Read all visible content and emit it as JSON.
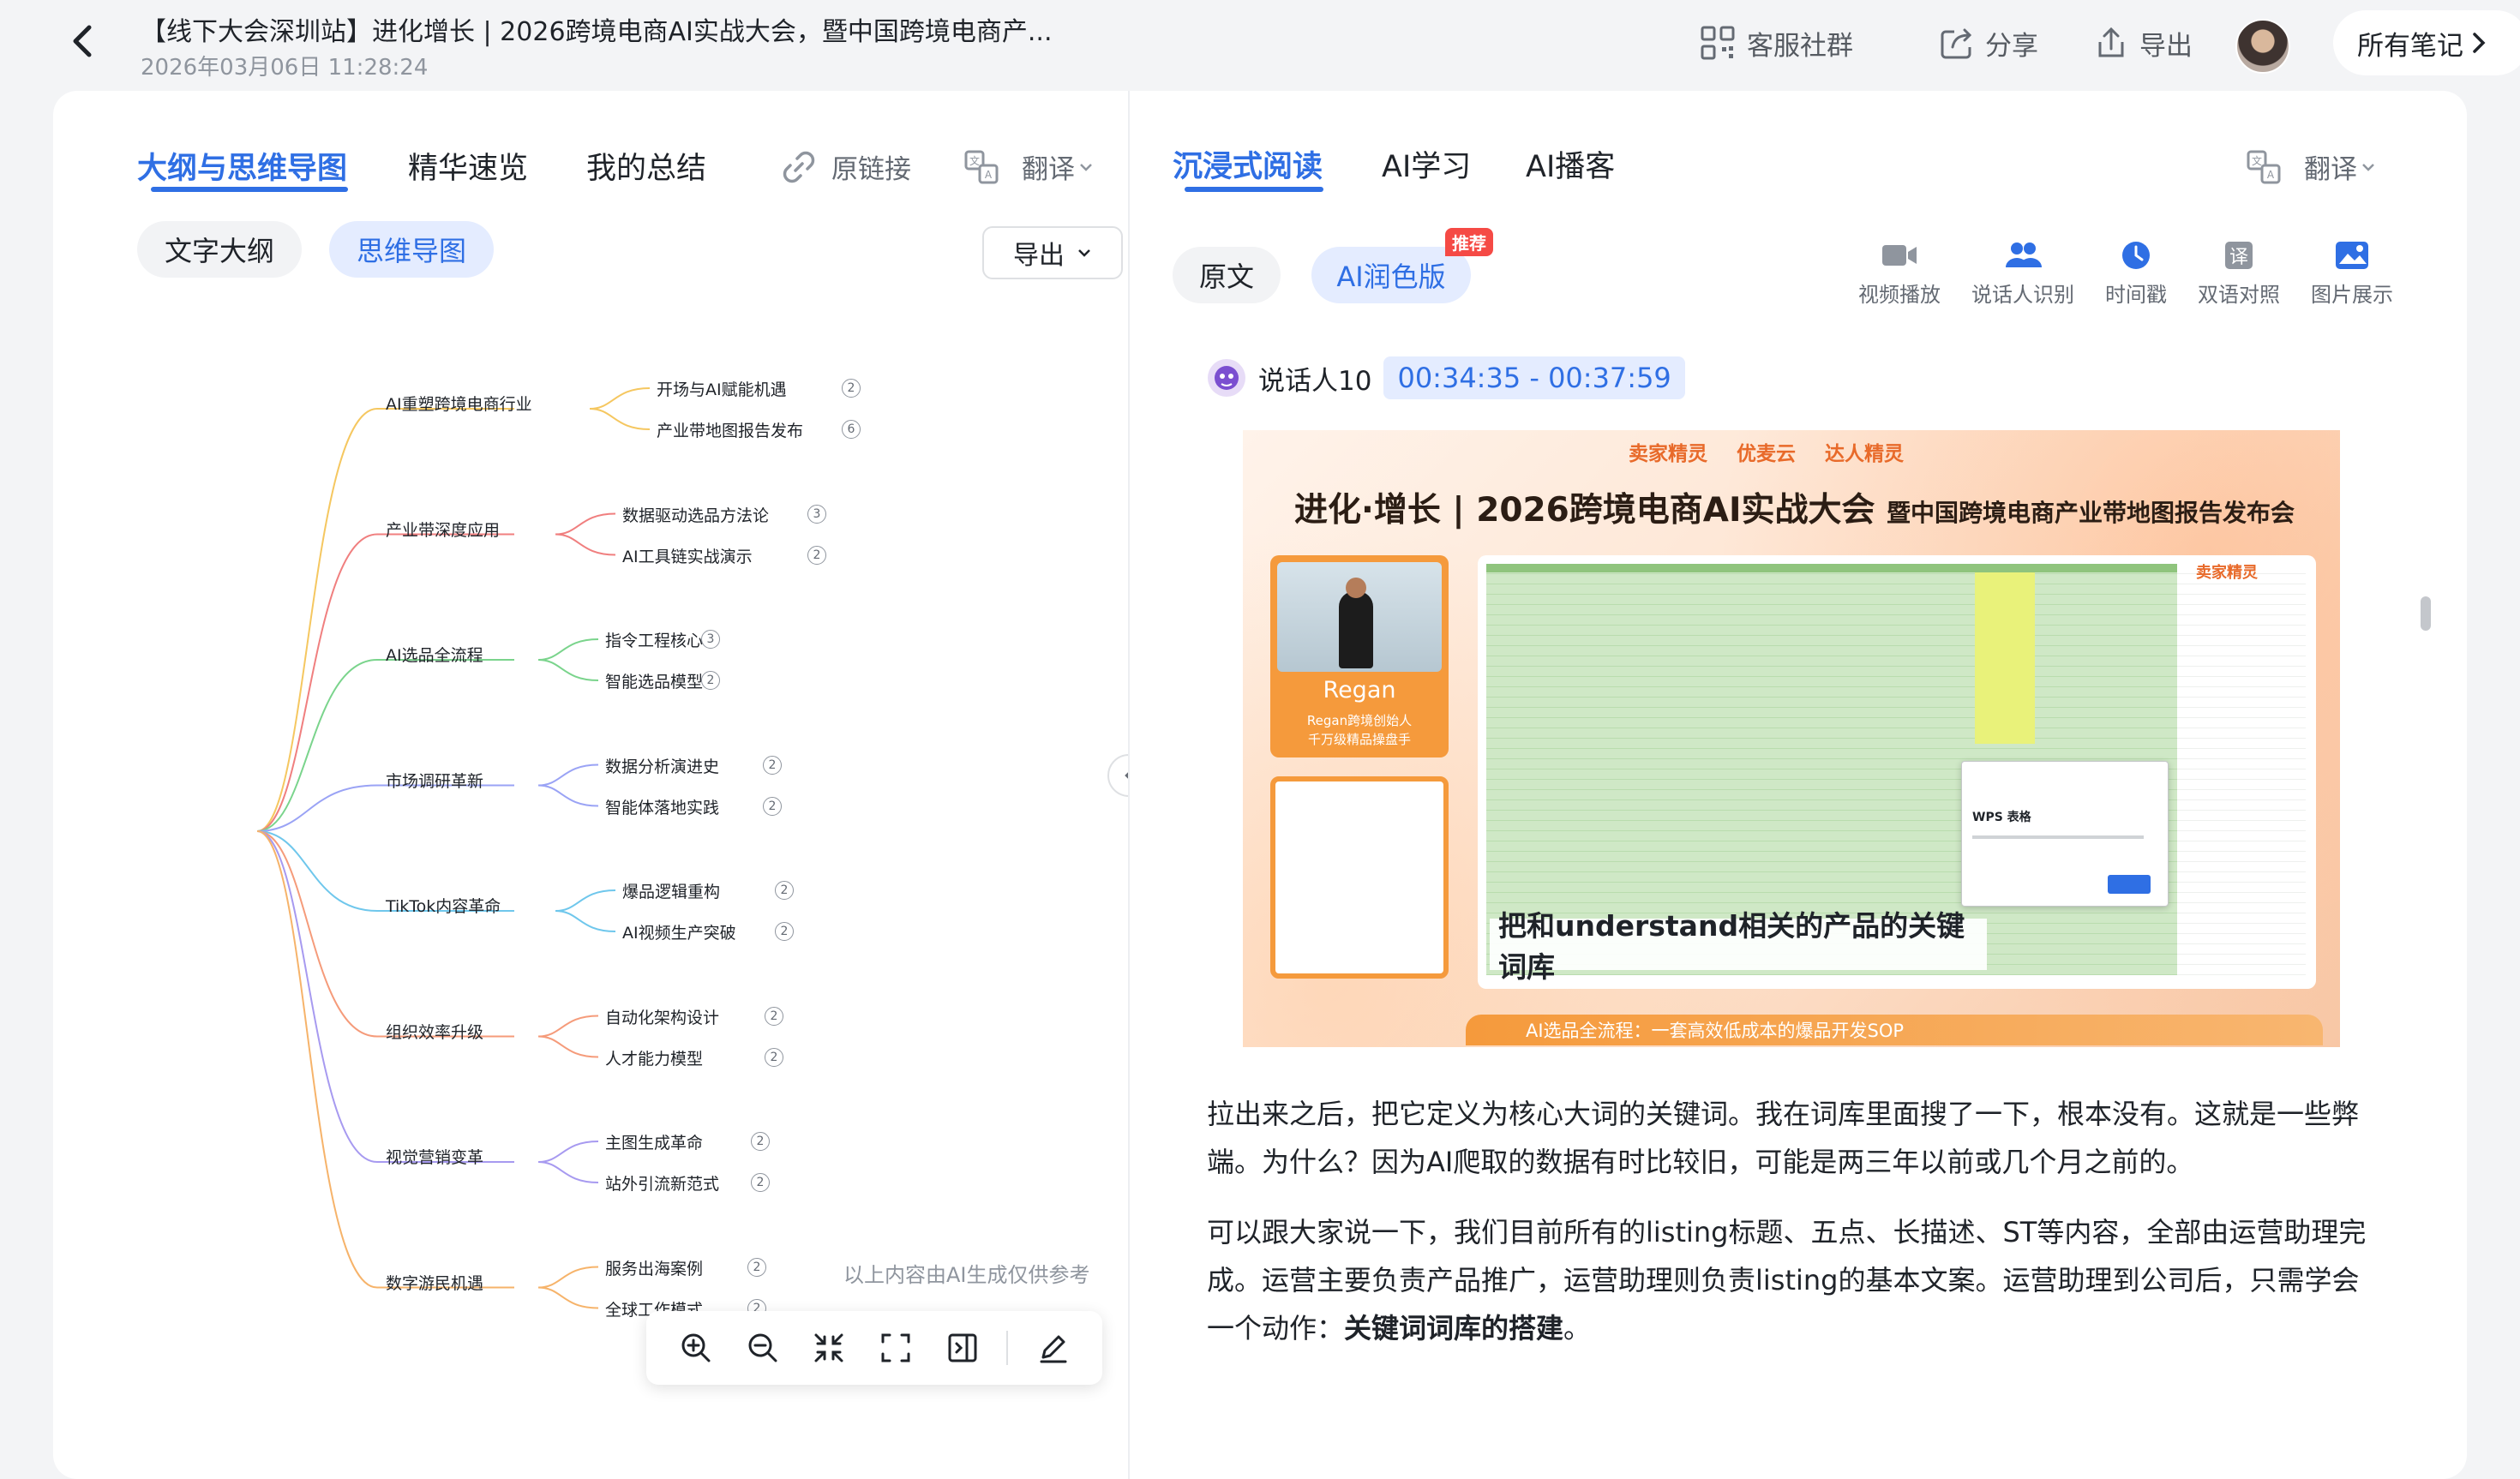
{
  "header": {
    "title": "【线下大会深圳站】进化增长 | 2026跨境电商AI实战大会，暨中国跨境电商产...",
    "datetime": "2026年03月06日 11:28:24",
    "customer_service": "客服社群",
    "share": "分享",
    "export": "导出",
    "all_notes": "所有笔记"
  },
  "left": {
    "tabs": [
      "大纲与思维导图",
      "精华速览",
      "我的总结"
    ],
    "source_link": "原链接",
    "translate": "翻译",
    "view_pills": [
      "文字大纲",
      "思维导图"
    ],
    "export_label": "导出",
    "ai_note": "以上内容由AI生成仅供参考",
    "mindmap": {
      "branches": [
        {
          "label": "AI重塑跨境电商行业",
          "color": "#f5c760",
          "children": [
            {
              "label": "开场与AI赋能机遇",
              "count": "2"
            },
            {
              "label": "产业带地图报告发布",
              "count": "6"
            }
          ]
        },
        {
          "label": "产业带深度应用",
          "color": "#f07f7f",
          "children": [
            {
              "label": "数据驱动选品方法论",
              "count": "3"
            },
            {
              "label": "AI工具链实战演示",
              "count": "2"
            }
          ]
        },
        {
          "label": "AI选品全流程",
          "color": "#7ad48c",
          "children": [
            {
              "label": "指令工程核心",
              "count": "3"
            },
            {
              "label": "智能选品模型",
              "count": "2"
            }
          ]
        },
        {
          "label": "市场调研革新",
          "color": "#9aa3f5",
          "children": [
            {
              "label": "数据分析演进史",
              "count": "2"
            },
            {
              "label": "智能体落地实践",
              "count": "2"
            }
          ]
        },
        {
          "label": "TikTok内容革命",
          "color": "#6fc7ec",
          "children": [
            {
              "label": "爆品逻辑重构",
              "count": "2"
            },
            {
              "label": "AI视频生产突破",
              "count": "2"
            }
          ]
        },
        {
          "label": "组织效率升级",
          "color": "#f59b7a",
          "children": [
            {
              "label": "自动化架构设计",
              "count": "2"
            },
            {
              "label": "人才能力模型",
              "count": "2"
            }
          ]
        },
        {
          "label": "视觉营销变革",
          "color": "#a79af0",
          "children": [
            {
              "label": "主图生成革命",
              "count": "2"
            },
            {
              "label": "站外引流新范式",
              "count": "2"
            }
          ]
        },
        {
          "label": "数字游民机遇",
          "color": "#f6b36a",
          "children": [
            {
              "label": "服务出海案例",
              "count": "2"
            },
            {
              "label": "全球工作模式",
              "count": "2"
            }
          ]
        }
      ]
    }
  },
  "right": {
    "tabs": [
      "沉浸式阅读",
      "AI学习",
      "AI播客"
    ],
    "translate": "翻译",
    "pills": [
      "原文",
      "AI润色版"
    ],
    "recommend_badge": "推荐",
    "tools": [
      {
        "label": "视频播放",
        "icon": "video-camera-icon"
      },
      {
        "label": "说话人识别",
        "icon": "speakers-icon"
      },
      {
        "label": "时间戳",
        "icon": "clock-icon"
      },
      {
        "label": "双语对照",
        "icon": "translate-icon"
      },
      {
        "label": "图片展示",
        "icon": "image-icon"
      }
    ],
    "speaker": {
      "name": "说话人10",
      "time": "00:34:35 - 00:37:59"
    },
    "slide": {
      "logos": [
        "卖家精灵",
        "优麦云",
        "达人精灵"
      ],
      "headline": "进化·增长 | 2026跨境电商AI实战大会",
      "headline_sub": "暨中国跨境电商产业带地图报告发布会",
      "speaker_name": "Regan",
      "speaker_role_1": "Regan跨境创始人",
      "speaker_role_2": "千万级精品操盘手",
      "caption": "把和understand相关的产品的关键词库",
      "footer": "AI选品全流程：一套高效低成本的爆品开发SOP",
      "corner_brand": "卖家精灵",
      "dialog_title": "WPS 表格"
    },
    "paragraphs": [
      {
        "text": "拉出来之后，把它定义为核心大词的关键词。我在词库里面搜了一下，根本没有。这就是一些弊端。为什么？因为AI爬取的数据有时比较旧，可能是两三年以前或几个月之前的。",
        "bold": ""
      },
      {
        "text": "可以跟大家说一下，我们目前所有的listing标题、五点、长描述、ST等内容，全部由运营助理完成。运营主要负责产品推广，运营助理则负责listing的基本文案。运营助理到公司后，只需学会一个动作：",
        "bold": "关键词词库的搭建",
        "tail": "。"
      }
    ]
  }
}
